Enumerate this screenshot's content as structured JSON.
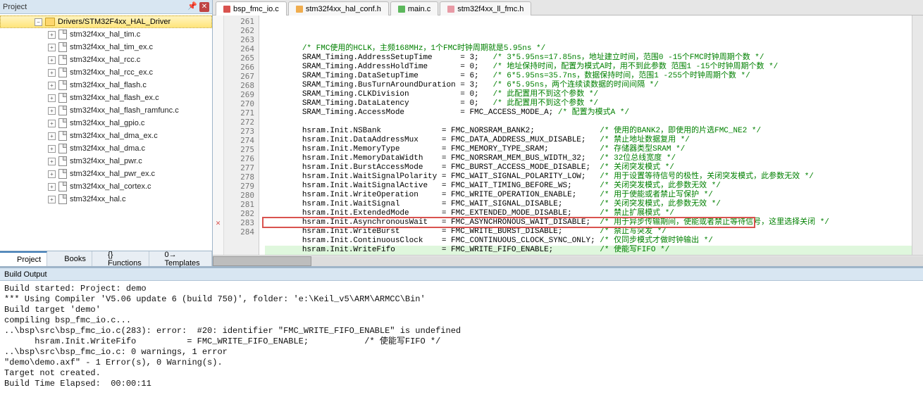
{
  "sidebar": {
    "title": "Project",
    "root_label": "Drivers/STM32F4xx_HAL_Driver",
    "files": [
      "stm32f4xx_hal_tim.c",
      "stm32f4xx_hal_tim_ex.c",
      "stm32f4xx_hal_rcc.c",
      "stm32f4xx_hal_rcc_ex.c",
      "stm32f4xx_hal_flash.c",
      "stm32f4xx_hal_flash_ex.c",
      "stm32f4xx_hal_flash_ramfunc.c",
      "stm32f4xx_hal_gpio.c",
      "stm32f4xx_hal_dma_ex.c",
      "stm32f4xx_hal_dma.c",
      "stm32f4xx_hal_pwr.c",
      "stm32f4xx_hal_pwr_ex.c",
      "stm32f4xx_hal_cortex.c",
      "stm32f4xx_hal.c"
    ]
  },
  "bottom_tabs": [
    {
      "icon": "project-icon",
      "label": "Project",
      "active": true
    },
    {
      "icon": "books-icon",
      "label": "Books",
      "active": false
    },
    {
      "icon": "functions-icon",
      "label": "{} Functions",
      "active": false
    },
    {
      "icon": "templates-icon",
      "label": "0→ Templates",
      "active": false
    }
  ],
  "editor_tabs": [
    {
      "color": "red",
      "label": "bsp_fmc_io.c",
      "active": true
    },
    {
      "color": "yellow",
      "label": "stm32f4xx_hal_conf.h",
      "active": false
    },
    {
      "color": "green",
      "label": "main.c",
      "active": false
    },
    {
      "color": "pinkish",
      "label": "stm32f4xx_ll_fmc.h",
      "active": false
    }
  ],
  "code": {
    "first_line": 261,
    "error_line": 283,
    "lines": [
      {
        "txt": "/* FMC使用的HCLK，主频168MHz，1个FMC时钟周期就是5.95ns */",
        "allcomment": true
      },
      {
        "lhs": "SRAM_Timing.AddressSetupTime      ",
        "rhs": "= 3;   ",
        "cmt": "/* 3*5.95ns=17.85ns，地址建立时间，范围0 -15个FMC时钟周期个数 */"
      },
      {
        "lhs": "SRAM_Timing.AddressHoldTime       ",
        "rhs": "= 0;   ",
        "cmt": "/* 地址保持时间，配置为模式A时，用不到此参数 范围1 -15个时钟周期个数 */"
      },
      {
        "lhs": "SRAM_Timing.DataSetupTime         ",
        "rhs": "= 6;   ",
        "cmt": "/* 6*5.95ns=35.7ns，数据保持时间，范围1 -255个时钟周期个数 */"
      },
      {
        "lhs": "SRAM_Timing.BusTurnAroundDuration ",
        "rhs": "= 3;   ",
        "cmt": "/* 6*5.95ns，两个连续读数据的时间间隔 */"
      },
      {
        "lhs": "SRAM_Timing.CLKDivision           ",
        "rhs": "= 0;   ",
        "cmt": "/* 此配置用不到这个参数 */"
      },
      {
        "lhs": "SRAM_Timing.DataLatency           ",
        "rhs": "= 0;   ",
        "cmt": "/* 此配置用不到这个参数 */"
      },
      {
        "lhs": "SRAM_Timing.AccessMode            ",
        "rhs": "= FMC_ACCESS_MODE_A; ",
        "cmt": "/* 配置为模式A */"
      },
      {
        "blank": true
      },
      {
        "lhs": "hsram.Init.NSBank             ",
        "rhs": "= FMC_NORSRAM_BANK2;              ",
        "cmt": "/* 使用的BANK2，即使用的片选FMC_NE2 */"
      },
      {
        "lhs": "hsram.Init.DataAddressMux     ",
        "rhs": "= FMC_DATA_ADDRESS_MUX_DISABLE;   ",
        "cmt": "/* 禁止地址数据复用 */"
      },
      {
        "lhs": "hsram.Init.MemoryType         ",
        "rhs": "= FMC_MEMORY_TYPE_SRAM;           ",
        "cmt": "/* 存储器类型SRAM */"
      },
      {
        "lhs": "hsram.Init.MemoryDataWidth    ",
        "rhs": "= FMC_NORSRAM_MEM_BUS_WIDTH_32;   ",
        "cmt": "/* 32位总线宽度 */"
      },
      {
        "lhs": "hsram.Init.BurstAccessMode    ",
        "rhs": "= FMC_BURST_ACCESS_MODE_DISABLE;  ",
        "cmt": "/* 关闭突发模式 */"
      },
      {
        "lhs": "hsram.Init.WaitSignalPolarity ",
        "rhs": "= FMC_WAIT_SIGNAL_POLARITY_LOW;   ",
        "cmt": "/* 用于设置等待信号的极性，关闭突发模式，此参数无效 */"
      },
      {
        "lhs": "hsram.Init.WaitSignalActive   ",
        "rhs": "= FMC_WAIT_TIMING_BEFORE_WS;      ",
        "cmt": "/* 关闭突发模式，此参数无效 */"
      },
      {
        "lhs": "hsram.Init.WriteOperation     ",
        "rhs": "= FMC_WRITE_OPERATION_ENABLE;     ",
        "cmt": "/* 用于使能或者禁止写保护 */"
      },
      {
        "lhs": "hsram.Init.WaitSignal         ",
        "rhs": "= FMC_WAIT_SIGNAL_DISABLE;        ",
        "cmt": "/* 关闭突发模式，此参数无效 */"
      },
      {
        "lhs": "hsram.Init.ExtendedMode       ",
        "rhs": "= FMC_EXTENDED_MODE_DISABLE;      ",
        "cmt": "/* 禁止扩展模式 */"
      },
      {
        "lhs": "hsram.Init.AsynchronousWait   ",
        "rhs": "= FMC_ASYNCHRONOUS_WAIT_DISABLE;  ",
        "cmt": "/* 用于异步传输期间，使能或者禁止等待信号，这里选择关闭 */"
      },
      {
        "lhs": "hsram.Init.WriteBurst         ",
        "rhs": "= FMC_WRITE_BURST_DISABLE;        ",
        "cmt": "/* 禁止写突发 */"
      },
      {
        "lhs": "hsram.Init.ContinuousClock    ",
        "rhs": "= FMC_CONTINUOUS_CLOCK_SYNC_ONLY; ",
        "cmt": "/* 仅同步模式才做时钟输出 */"
      },
      {
        "lhs": "hsram.Init.WriteFifo          ",
        "rhs": "= FMC_WRITE_FIFO_ENABLE;          ",
        "cmt": "/* 使能写FIFO */",
        "hl": true
      },
      {
        "blank": true
      }
    ]
  },
  "build": {
    "title": "Build Output",
    "lines": [
      "Build started: Project: demo",
      "*** Using Compiler 'V5.06 update 6 (build 750)', folder: 'e:\\Keil_v5\\ARM\\ARMCC\\Bin'",
      "Build target 'demo'",
      "compiling bsp_fmc_io.c...",
      "..\\bsp\\src\\bsp_fmc_io.c(283): error:  #20: identifier \"FMC_WRITE_FIFO_ENABLE\" is undefined",
      "      hsram.Init.WriteFifo          = FMC_WRITE_FIFO_ENABLE;           /* 使能写FIFO */",
      "..\\bsp\\src\\bsp_fmc_io.c: 0 warnings, 1 error",
      "\"demo\\demo.axf\" - 1 Error(s), 0 Warning(s).",
      "Target not created.",
      "Build Time Elapsed:  00:00:11"
    ]
  }
}
